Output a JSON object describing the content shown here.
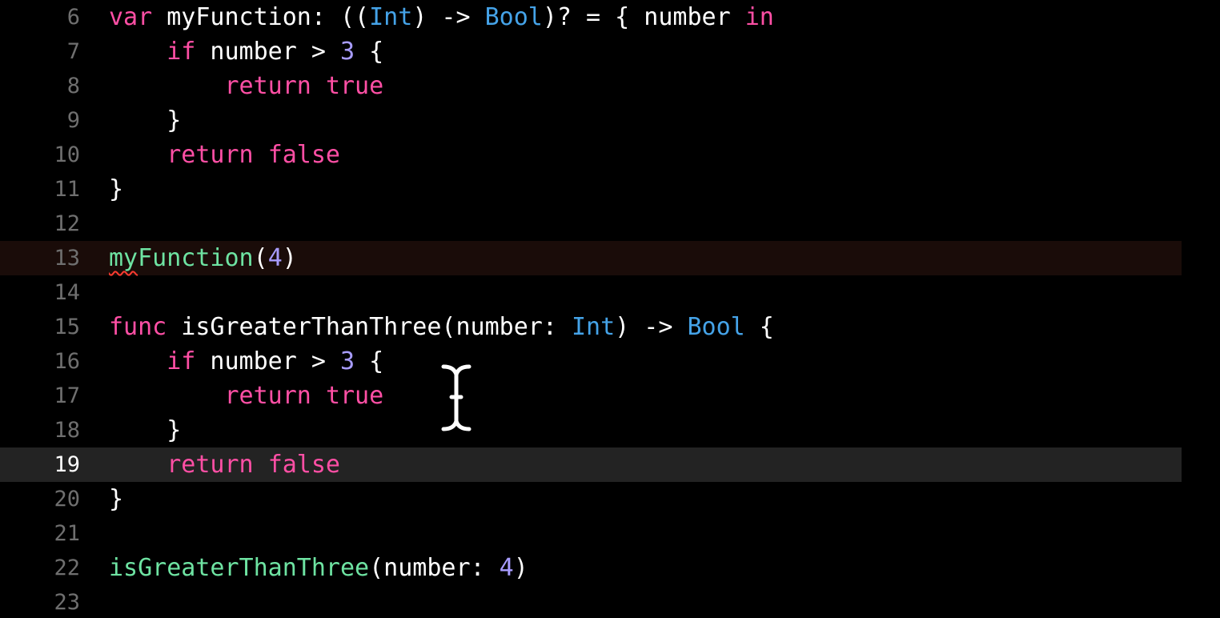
{
  "editor": {
    "colors": {
      "background": "#000000",
      "line_number": "#6f6f6f",
      "keyword": "#ff4fa5",
      "type": "#45a3e8",
      "number": "#a89cff",
      "function_call": "#6ee3a2",
      "plain": "#ffffff",
      "error_underline": "#ff3b30",
      "current_line_bg": "#232323",
      "error_line_bg": "#1a0c09"
    },
    "cursor_icon": "i-beam-cursor-icon",
    "lines": [
      {
        "number": "6",
        "highlight": "",
        "tokens": [
          {
            "t": "var",
            "c": "kw"
          },
          {
            "t": " myFunction: ((",
            "c": "plain"
          },
          {
            "t": "Int",
            "c": "type"
          },
          {
            "t": ") -> ",
            "c": "plain"
          },
          {
            "t": "Bool",
            "c": "type"
          },
          {
            "t": ")? = { number ",
            "c": "plain"
          },
          {
            "t": "in",
            "c": "kw"
          }
        ]
      },
      {
        "number": "7",
        "highlight": "",
        "tokens": [
          {
            "t": "    ",
            "c": "plain"
          },
          {
            "t": "if",
            "c": "kw"
          },
          {
            "t": " number > ",
            "c": "plain"
          },
          {
            "t": "3",
            "c": "num"
          },
          {
            "t": " {",
            "c": "plain"
          }
        ]
      },
      {
        "number": "8",
        "highlight": "",
        "tokens": [
          {
            "t": "        ",
            "c": "plain"
          },
          {
            "t": "return",
            "c": "kw"
          },
          {
            "t": " ",
            "c": "plain"
          },
          {
            "t": "true",
            "c": "kw"
          }
        ]
      },
      {
        "number": "9",
        "highlight": "",
        "tokens": [
          {
            "t": "    }",
            "c": "plain"
          }
        ]
      },
      {
        "number": "10",
        "highlight": "",
        "tokens": [
          {
            "t": "    ",
            "c": "plain"
          },
          {
            "t": "return",
            "c": "kw"
          },
          {
            "t": " ",
            "c": "plain"
          },
          {
            "t": "false",
            "c": "kw"
          }
        ]
      },
      {
        "number": "11",
        "highlight": "",
        "tokens": [
          {
            "t": "}",
            "c": "plain"
          }
        ]
      },
      {
        "number": "12",
        "highlight": "",
        "tokens": []
      },
      {
        "number": "13",
        "highlight": "error",
        "tokens": [
          {
            "t": "my",
            "c": "call err"
          },
          {
            "t": "Function",
            "c": "call"
          },
          {
            "t": "(",
            "c": "plain"
          },
          {
            "t": "4",
            "c": "num"
          },
          {
            "t": ")",
            "c": "plain"
          }
        ]
      },
      {
        "number": "14",
        "highlight": "",
        "tokens": []
      },
      {
        "number": "15",
        "highlight": "",
        "tokens": [
          {
            "t": "func",
            "c": "kw"
          },
          {
            "t": " isGreaterThanThree(number: ",
            "c": "plain"
          },
          {
            "t": "Int",
            "c": "type"
          },
          {
            "t": ") -> ",
            "c": "plain"
          },
          {
            "t": "Bool",
            "c": "type"
          },
          {
            "t": " {",
            "c": "plain"
          }
        ]
      },
      {
        "number": "16",
        "highlight": "",
        "tokens": [
          {
            "t": "    ",
            "c": "plain"
          },
          {
            "t": "if",
            "c": "kw"
          },
          {
            "t": " number > ",
            "c": "plain"
          },
          {
            "t": "3",
            "c": "num"
          },
          {
            "t": " {",
            "c": "plain"
          }
        ]
      },
      {
        "number": "17",
        "highlight": "",
        "tokens": [
          {
            "t": "        ",
            "c": "plain"
          },
          {
            "t": "return",
            "c": "kw"
          },
          {
            "t": " ",
            "c": "plain"
          },
          {
            "t": "true",
            "c": "kw"
          }
        ]
      },
      {
        "number": "18",
        "highlight": "",
        "tokens": [
          {
            "t": "    }",
            "c": "plain"
          }
        ]
      },
      {
        "number": "19",
        "highlight": "current",
        "tokens": [
          {
            "t": "    ",
            "c": "plain"
          },
          {
            "t": "return",
            "c": "kw"
          },
          {
            "t": " ",
            "c": "plain"
          },
          {
            "t": "false",
            "c": "kw"
          }
        ]
      },
      {
        "number": "20",
        "highlight": "",
        "tokens": [
          {
            "t": "}",
            "c": "plain"
          }
        ]
      },
      {
        "number": "21",
        "highlight": "",
        "tokens": []
      },
      {
        "number": "22",
        "highlight": "",
        "tokens": [
          {
            "t": "isGreaterThanThree",
            "c": "call"
          },
          {
            "t": "(number: ",
            "c": "plain"
          },
          {
            "t": "4",
            "c": "num"
          },
          {
            "t": ")",
            "c": "plain"
          }
        ]
      },
      {
        "number": "23",
        "highlight": "",
        "tokens": []
      }
    ]
  }
}
